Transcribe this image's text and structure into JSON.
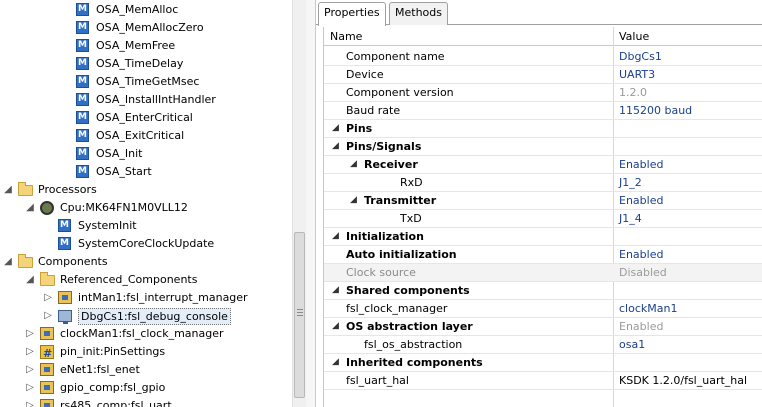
{
  "tree": {
    "items": [
      {
        "label": "OSA_MemAlloc",
        "icon": "m-icon",
        "level": 3,
        "twist": ""
      },
      {
        "label": "OSA_MemAllocZero",
        "icon": "m-icon",
        "level": 3,
        "twist": ""
      },
      {
        "label": "OSA_MemFree",
        "icon": "m-icon",
        "level": 3,
        "twist": ""
      },
      {
        "label": "OSA_TimeDelay",
        "icon": "m-icon",
        "level": 3,
        "twist": ""
      },
      {
        "label": "OSA_TimeGetMsec",
        "icon": "m-icon",
        "level": 3,
        "twist": ""
      },
      {
        "label": "OSA_InstallIntHandler",
        "icon": "m-icon",
        "level": 3,
        "twist": ""
      },
      {
        "label": "OSA_EnterCritical",
        "icon": "m-icon",
        "level": 3,
        "twist": ""
      },
      {
        "label": "OSA_ExitCritical",
        "icon": "m-icon",
        "level": 3,
        "twist": ""
      },
      {
        "label": "OSA_Init",
        "icon": "m-icon",
        "level": 3,
        "twist": ""
      },
      {
        "label": "OSA_Start",
        "icon": "m-icon",
        "level": 3,
        "twist": ""
      },
      {
        "label": "Processors",
        "icon": "folder-icon",
        "level": 0,
        "twist": "expanded"
      },
      {
        "label": "Cpu:MK64FN1M0VLL12",
        "icon": "cpu-icon",
        "level": 1,
        "twist": "expanded"
      },
      {
        "label": "SystemInit",
        "icon": "m-icon",
        "level": 2,
        "twist": ""
      },
      {
        "label": "SystemCoreClockUpdate",
        "icon": "m-icon",
        "level": 2,
        "twist": ""
      },
      {
        "label": "Components",
        "icon": "folder-icon",
        "level": 0,
        "twist": "expanded"
      },
      {
        "label": "Referenced_Components",
        "icon": "folder-icon",
        "level": 1,
        "twist": "expanded"
      },
      {
        "label": "intMan1:fsl_interrupt_manager",
        "icon": "component-icon",
        "level": 2,
        "twist": "collapsed"
      },
      {
        "label": "DbgCs1:fsl_debug_console",
        "icon": "monitor-icon",
        "level": 2,
        "twist": "collapsed",
        "selected": true
      },
      {
        "label": "clockMan1:fsl_clock_manager",
        "icon": "component-icon",
        "level": 1,
        "twist": "collapsed"
      },
      {
        "label": "pin_init:PinSettings",
        "icon": "pin-icon",
        "level": 1,
        "twist": "collapsed"
      },
      {
        "label": "eNet1:fsl_enet",
        "icon": "component-icon",
        "level": 1,
        "twist": "collapsed"
      },
      {
        "label": "gpio_comp:fsl_gpio",
        "icon": "component-icon",
        "level": 1,
        "twist": "collapsed"
      },
      {
        "label": "rs485_comp:fsl_uart",
        "icon": "component-icon",
        "level": 1,
        "twist": "collapsed"
      }
    ]
  },
  "tabs": [
    {
      "label": "Properties",
      "active": true
    },
    {
      "label": "Methods",
      "active": false
    }
  ],
  "table": {
    "header_name": "Name",
    "header_value": "Value",
    "rows": [
      {
        "name": "Component name",
        "value": "DbgCs1",
        "level": 1,
        "bold": false,
        "arrow": "",
        "valstyle": "link"
      },
      {
        "name": "Device",
        "value": "UART3",
        "level": 1,
        "bold": false,
        "arrow": "",
        "valstyle": "link"
      },
      {
        "name": "Component version",
        "value": "1.2.0",
        "level": 1,
        "bold": false,
        "arrow": "",
        "valstyle": "gray"
      },
      {
        "name": "Baud rate",
        "value": "115200 baud",
        "level": 1,
        "bold": false,
        "arrow": "",
        "valstyle": "link"
      },
      {
        "name": "Pins",
        "value": "",
        "level": 0,
        "bold": true,
        "arrow": "expanded",
        "valstyle": "link"
      },
      {
        "name": "Pins/Signals",
        "value": "",
        "level": 1,
        "bold": true,
        "arrow": "expanded",
        "valstyle": "link"
      },
      {
        "name": "Receiver",
        "value": "Enabled",
        "level": 2,
        "bold": true,
        "arrow": "expanded",
        "valstyle": "link"
      },
      {
        "name": "RxD",
        "value": "J1_2",
        "level": 4,
        "bold": false,
        "arrow": "",
        "valstyle": "link"
      },
      {
        "name": "Transmitter",
        "value": "Enabled",
        "level": 2,
        "bold": true,
        "arrow": "expanded",
        "valstyle": "link"
      },
      {
        "name": "TxD",
        "value": "J1_4",
        "level": 4,
        "bold": false,
        "arrow": "",
        "valstyle": "link"
      },
      {
        "name": "Initialization",
        "value": "",
        "level": 0,
        "bold": true,
        "arrow": "expanded",
        "valstyle": "link"
      },
      {
        "name": "Auto initialization",
        "value": "Enabled",
        "level": 1,
        "bold": true,
        "arrow": "",
        "valstyle": "link"
      },
      {
        "name": "Clock source",
        "value": "Disabled",
        "level": 1,
        "bold": false,
        "arrow": "",
        "valstyle": "gray",
        "selected": true
      },
      {
        "name": "Shared components",
        "value": "",
        "level": 0,
        "bold": true,
        "arrow": "expanded",
        "valstyle": "link"
      },
      {
        "name": "fsl_clock_manager",
        "value": "clockMan1",
        "level": 1,
        "bold": false,
        "arrow": "",
        "valstyle": "link"
      },
      {
        "name": "OS abstraction layer",
        "value": "Enabled",
        "level": 1,
        "bold": true,
        "arrow": "expanded",
        "valstyle": "gray"
      },
      {
        "name": "fsl_os_abstraction",
        "value": "osa1",
        "level": 2,
        "bold": false,
        "arrow": "",
        "valstyle": "link"
      },
      {
        "name": "Inherited components",
        "value": "",
        "level": 0,
        "bold": true,
        "arrow": "expanded",
        "valstyle": "link"
      },
      {
        "name": "fsl_uart_hal",
        "value": "KSDK 1.2.0/fsl_uart_hal",
        "level": 1,
        "bold": false,
        "arrow": "",
        "valstyle": "blk"
      }
    ]
  },
  "colors": {
    "link": "#1a3f8f",
    "disabled": "#9a9a9a",
    "selection": "#e4eef9"
  }
}
